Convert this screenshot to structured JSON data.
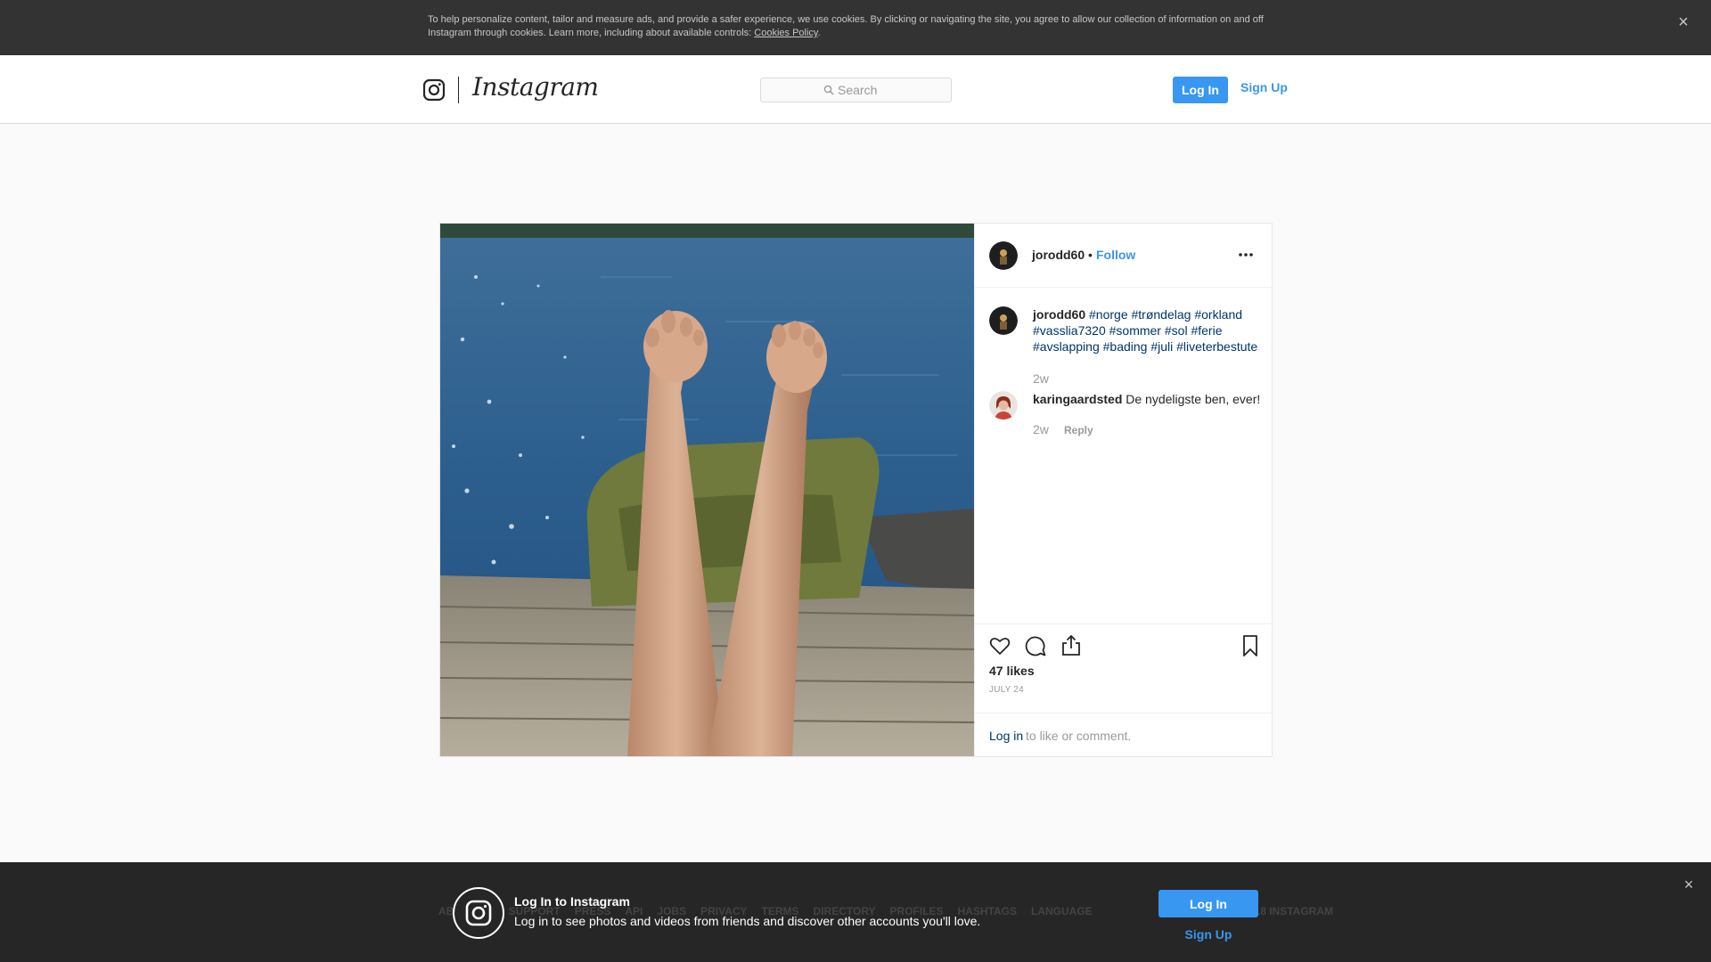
{
  "cookie_banner": {
    "text": "To help personalize content, tailor and measure ads, and provide a safer experience, we use cookies. By clicking or navigating the site, you agree to allow our collection of information on and off Instagram through cookies. Learn more, including about available controls: ",
    "link_label": "Cookies Policy",
    "trailing": ".",
    "close_icon": "×"
  },
  "header": {
    "brand": "Instagram",
    "search_placeholder": "Search",
    "login_label": "Log In",
    "signup_label": "Sign Up"
  },
  "post": {
    "author": "jorodd60",
    "separator": "•",
    "follow_label": "Follow",
    "caption_user": "jorodd60",
    "hashtags": [
      "#norge",
      "#trøndelag",
      "#orkland",
      "#vasslia7320",
      "#sommer",
      "#sol",
      "#ferie",
      "#avslapping",
      "#bading",
      "#juli",
      "#liveterbestute"
    ],
    "caption_time": "2w",
    "comments": [
      {
        "user": "karingaardsted",
        "text": "De nydeligste ben, ever!",
        "time": "2w",
        "reply_label": "Reply"
      }
    ],
    "likes": "47 likes",
    "date": "JULY 24",
    "login_link": "Log in",
    "login_rest": "to like or comment."
  },
  "footer": {
    "links": [
      "ABOUT US",
      "SUPPORT",
      "PRESS",
      "API",
      "JOBS",
      "PRIVACY",
      "TERMS",
      "DIRECTORY",
      "PROFILES",
      "HASHTAGS",
      "LANGUAGE"
    ],
    "copyright": "© 2018 INSTAGRAM"
  },
  "login_overlay": {
    "title": "Log In to Instagram",
    "subtitle": "Log in to see photos and videos from friends and discover other accounts you'll love.",
    "login_label": "Log In",
    "signup_label": "Sign Up",
    "close_icon": "×"
  },
  "icons": {
    "logo": "instagram-glyph-icon",
    "search": "search-icon",
    "more": "more-options-icon",
    "like": "heart-icon",
    "comment": "comment-bubble-icon",
    "share": "share-icon",
    "save": "bookmark-icon"
  },
  "colors": {
    "accent": "#3897f0",
    "hashtag": "#003569",
    "banner_bg": "#333333",
    "overlay_bg": "#262626"
  }
}
